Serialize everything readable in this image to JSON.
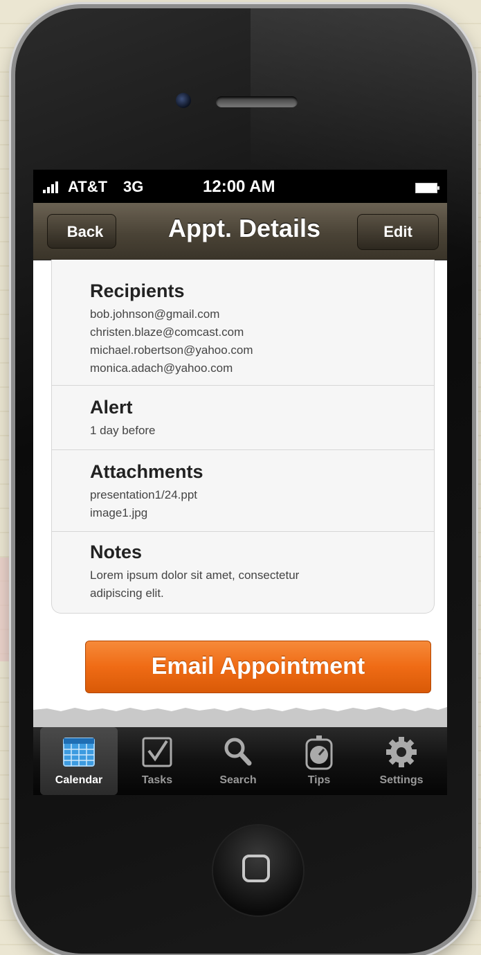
{
  "status_bar": {
    "carrier": "AT&T",
    "network": "3G",
    "time": "12:00 AM"
  },
  "nav_bar": {
    "back_label": "Back",
    "title": "Appt. Details",
    "edit_label": "Edit"
  },
  "details": {
    "recipients": {
      "title": "Recipients",
      "lines": [
        "bob.johnson@gmail.com",
        "christen.blaze@comcast.com",
        "michael.robertson@yahoo.com",
        "monica.adach@yahoo.com"
      ]
    },
    "alert": {
      "title": "Alert",
      "lines": [
        "1 day before"
      ]
    },
    "attachments": {
      "title": "Attachments",
      "lines": [
        "presentation1/24.ppt",
        "image1.jpg"
      ]
    },
    "notes": {
      "title": "Notes",
      "lines": [
        "Lorem ipsum dolor sit amet, consectetur",
        "adipiscing elit."
      ]
    }
  },
  "email_button_label": "Email Appointment",
  "tab_bar": {
    "tabs": [
      {
        "label": "Calendar",
        "icon": "calendar-icon",
        "active": true
      },
      {
        "label": "Tasks",
        "icon": "checkbox-icon",
        "active": false
      },
      {
        "label": "Search",
        "icon": "search-icon",
        "active": false
      },
      {
        "label": "Tips",
        "icon": "stopwatch-icon",
        "active": false
      },
      {
        "label": "Settings",
        "icon": "gear-icon",
        "active": false
      }
    ]
  },
  "colors": {
    "accent_orange": "#ef6b15",
    "nav_brown": "#4a4336",
    "calendar_blue": "#3d9be0"
  }
}
